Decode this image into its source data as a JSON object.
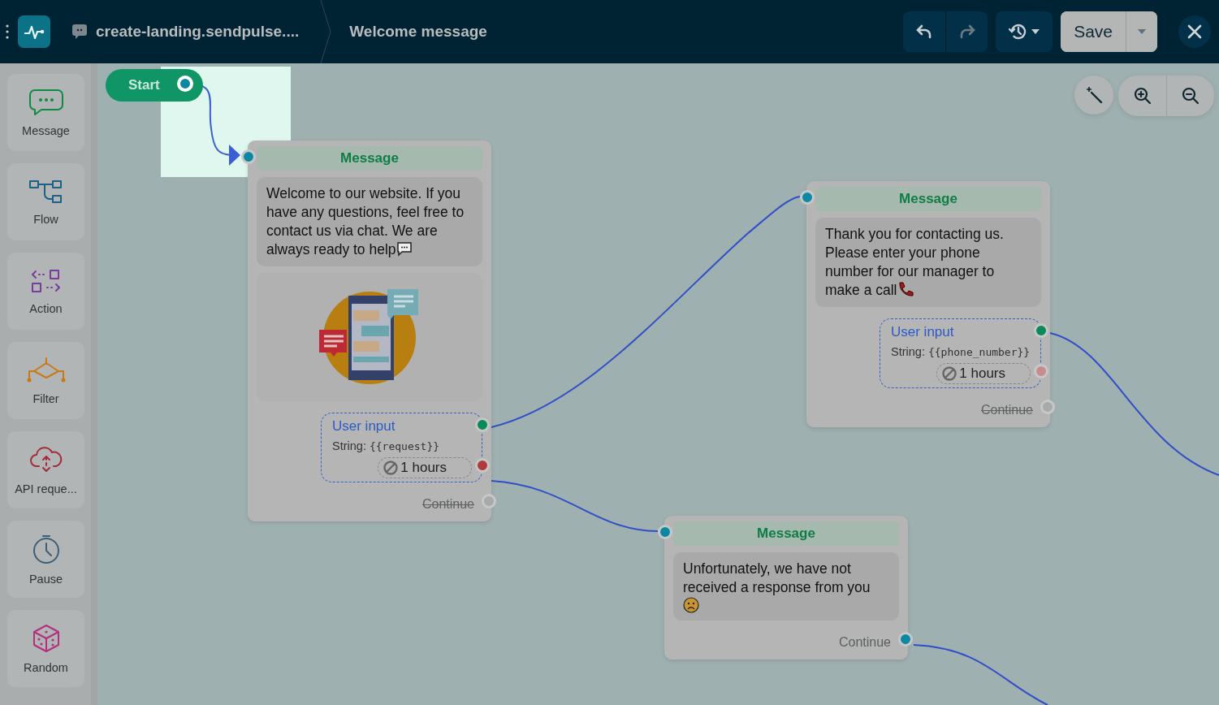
{
  "header": {
    "bot_name": "create-landing.sendpulse....",
    "flow_name": "Welcome message",
    "save_label": "Save"
  },
  "sidebar": {
    "items": [
      {
        "label": "Message",
        "kind": "message"
      },
      {
        "label": "Flow",
        "kind": "flow"
      },
      {
        "label": "Action",
        "kind": "action"
      },
      {
        "label": "Filter",
        "kind": "filter"
      },
      {
        "label": "API reque...",
        "kind": "api"
      },
      {
        "label": "Pause",
        "kind": "pause"
      },
      {
        "label": "Random",
        "kind": "random"
      }
    ]
  },
  "canvas": {
    "start_label": "Start",
    "nodes": [
      {
        "title": "Message",
        "text": "Welcome to our website. If you have any questions, feel free to contact us via chat. We are always ready to help",
        "has_image": true,
        "user_input": {
          "title": "User input",
          "variable_label": "String:",
          "variable": "{{request}}",
          "timeout": "1 hours",
          "timeout_connected": true
        },
        "continue": {
          "label": "Continue",
          "disabled": true
        }
      },
      {
        "title": "Message",
        "text": "Thank you for contacting us. Please enter your phone number for our manager to make a call",
        "has_image": false,
        "user_input": {
          "title": "User input",
          "variable_label": "String:",
          "variable": "{{phone_number}}",
          "timeout": "1 hours",
          "timeout_connected": false
        },
        "continue": {
          "label": "Continue",
          "disabled": true
        }
      },
      {
        "title": "Message",
        "text": "Unfortunately, we have not received a response from you",
        "has_image": false,
        "continue": {
          "label": "Continue",
          "disabled": false
        }
      }
    ]
  }
}
